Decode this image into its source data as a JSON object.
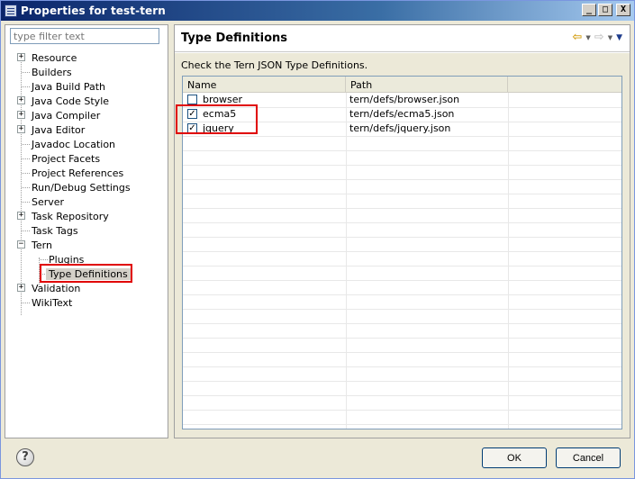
{
  "window": {
    "title": "Properties for test-tern",
    "minimize_glyph": "_",
    "maximize_glyph": "□",
    "close_glyph": "X"
  },
  "filter": {
    "placeholder": "type filter text",
    "value": ""
  },
  "tree": {
    "items": [
      {
        "label": "Resource",
        "expandable": true,
        "expanded": false
      },
      {
        "label": "Builders",
        "expandable": false
      },
      {
        "label": "Java Build Path",
        "expandable": false
      },
      {
        "label": "Java Code Style",
        "expandable": true,
        "expanded": false
      },
      {
        "label": "Java Compiler",
        "expandable": true,
        "expanded": false
      },
      {
        "label": "Java Editor",
        "expandable": true,
        "expanded": false
      },
      {
        "label": "Javadoc Location",
        "expandable": false
      },
      {
        "label": "Project Facets",
        "expandable": false
      },
      {
        "label": "Project References",
        "expandable": false
      },
      {
        "label": "Run/Debug Settings",
        "expandable": false
      },
      {
        "label": "Server",
        "expandable": false
      },
      {
        "label": "Task Repository",
        "expandable": true,
        "expanded": false
      },
      {
        "label": "Task Tags",
        "expandable": false
      },
      {
        "label": "Tern",
        "expandable": true,
        "expanded": true
      },
      {
        "label": "Plugins",
        "child": true
      },
      {
        "label": "Type Definitions",
        "child": true,
        "selected": true
      },
      {
        "label": "Validation",
        "expandable": true,
        "expanded": false
      },
      {
        "label": "WikiText",
        "expandable": false
      }
    ]
  },
  "page": {
    "title": "Type Definitions",
    "description": "Check the Tern JSON Type Definitions.",
    "nav": {
      "back_icon": "back-arrow-icon",
      "forward_icon": "forward-arrow-icon",
      "menu_icon": "view-menu-icon"
    }
  },
  "table": {
    "columns": [
      "Name",
      "Path",
      ""
    ],
    "rows": [
      {
        "name": "browser",
        "path": "tern/defs/browser.json",
        "checked": false
      },
      {
        "name": "ecma5",
        "path": "tern/defs/ecma5.json",
        "checked": true
      },
      {
        "name": "jquery",
        "path": "tern/defs/jquery.json",
        "checked": true
      }
    ]
  },
  "buttons": {
    "help": "?",
    "ok": "OK",
    "cancel": "Cancel"
  },
  "colors": {
    "highlight_box": "#e00000",
    "title_bar": "#0a246a"
  }
}
